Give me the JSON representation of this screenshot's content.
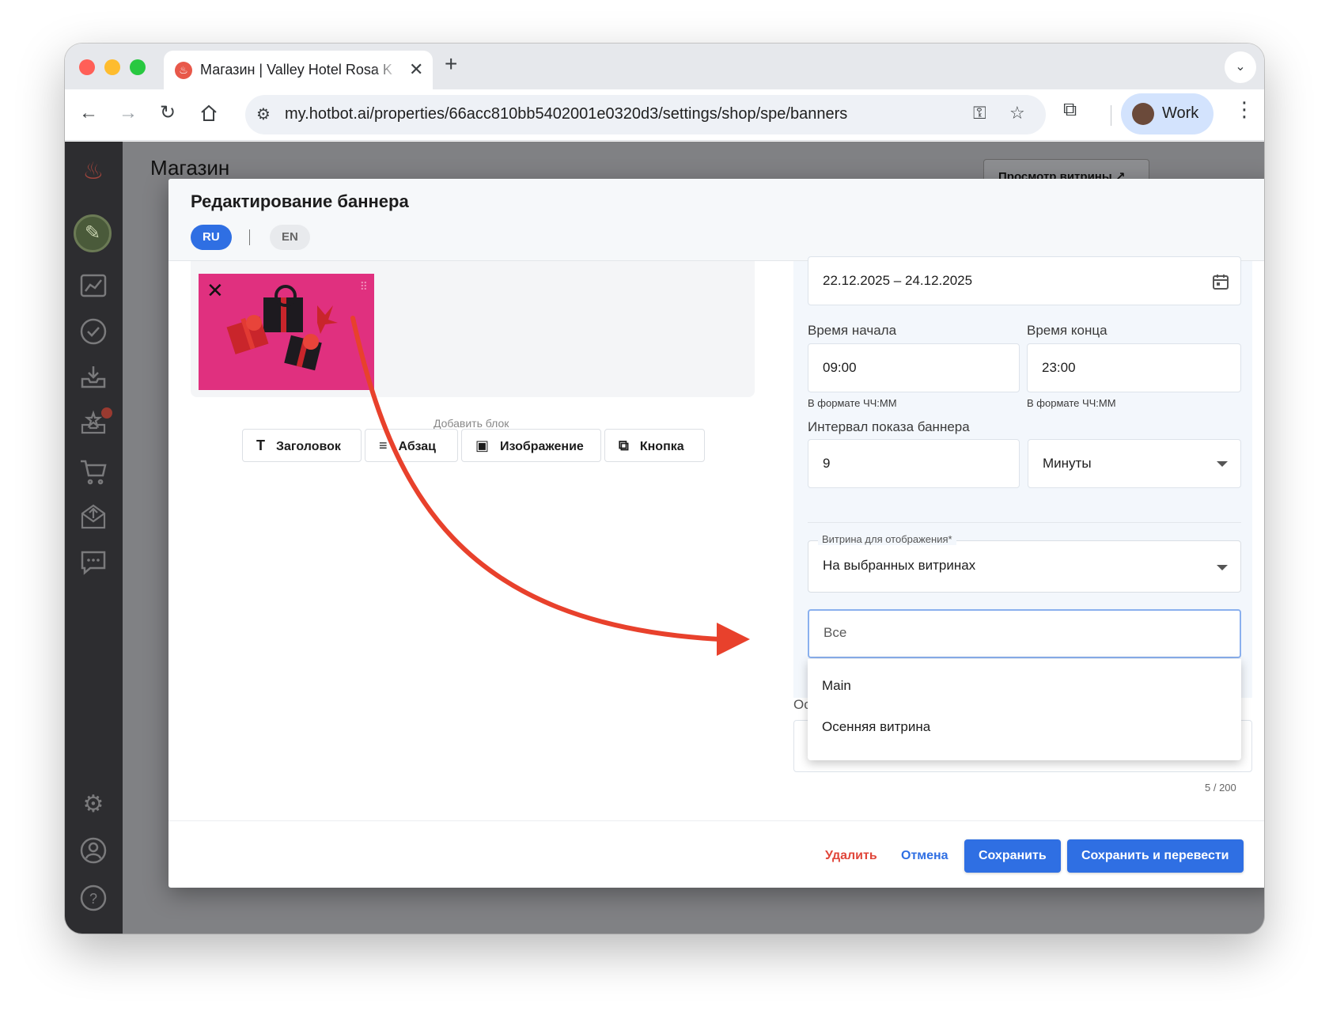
{
  "browser": {
    "tab_title": "Магазин | Valley Hotel Rosa K",
    "url": "my.hotbot.ai/properties/66acc810bb5402001e0320d3/settings/shop/spe/banners",
    "profile_name": "Work",
    "traffic_lights": {
      "close": "#ff5f57",
      "minimize": "#febc2e",
      "maximize": "#28c840"
    }
  },
  "page": {
    "title": "Магазин",
    "preview_button": "Просмотр витрины ↗"
  },
  "sidebar": {
    "icons": [
      "flame-logo-icon",
      "avatar-icon",
      "analytics-icon",
      "tasks-icon",
      "inbox-icon",
      "reviews-icon",
      "shop-icon",
      "mail-icon",
      "chat-icon",
      "settings-icon",
      "profile-icon",
      "help-icon"
    ]
  },
  "modal": {
    "title": "Редактирование баннера",
    "languages": {
      "ru": "RU",
      "en": "EN",
      "active": "RU"
    },
    "add_block_label": "Добавить блок",
    "blocks": {
      "heading": "Заголовок",
      "paragraph": "Абзац",
      "image": "Изображение",
      "button": "Кнопка"
    },
    "period_value": "22.12.2025 – 24.12.2025",
    "start_time": {
      "label": "Время начала",
      "value": "09:00",
      "hint": "В формате ЧЧ:ММ"
    },
    "end_time": {
      "label": "Время конца",
      "value": "23:00",
      "hint": "В формате ЧЧ:ММ"
    },
    "interval": {
      "label": "Интервал показа баннера",
      "value": "9",
      "unit": "Минуты"
    },
    "showcase": {
      "label": "Витрина для отображения*",
      "value": "На выбранных витринах"
    },
    "showcase_search": {
      "placeholder": "Все"
    },
    "showcase_options": [
      "Main",
      "Осенняя витрина"
    ],
    "description_label_visible": "Ос",
    "char_counter": "5 / 200",
    "footer": {
      "delete": "Удалить",
      "cancel": "Отмена",
      "save": "Сохранить",
      "save_translate": "Сохранить и перевести"
    }
  },
  "colors": {
    "primary": "#2f6fe3",
    "danger": "#e0463a",
    "annotation_arrow": "#e8412c",
    "banner_bg": "#e0307f"
  }
}
